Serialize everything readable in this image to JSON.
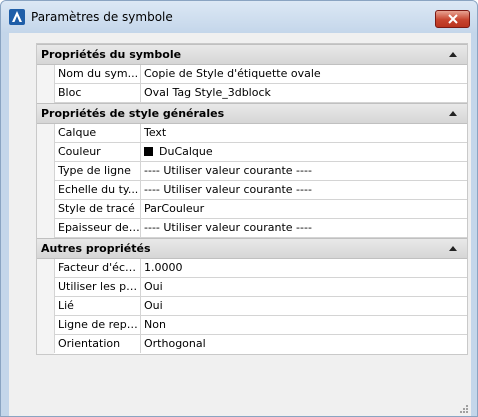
{
  "window": {
    "title": "Paramètres de symbole",
    "close_label": "×"
  },
  "categories": [
    {
      "title": "Propriétés du symbole",
      "rows": [
        {
          "name": "Nom du sym...",
          "value": "Copie de Style d'étiquette ovale"
        },
        {
          "name": "Bloc",
          "value": "Oval Tag Style_3dblock"
        }
      ]
    },
    {
      "title": "Propriétés de style générales",
      "rows": [
        {
          "name": "Calque",
          "value": "Text"
        },
        {
          "name": "Couleur",
          "value": "DuCalque",
          "swatch": "#000000"
        },
        {
          "name": "Type de ligne",
          "value": "---- Utiliser valeur courante ----"
        },
        {
          "name": "Echelle du ty...",
          "value": "---- Utiliser valeur courante ----"
        },
        {
          "name": "Style de tracé",
          "value": "ParCouleur"
        },
        {
          "name": "Epaisseur de l...",
          "value": "---- Utiliser valeur courante ----"
        }
      ]
    },
    {
      "title": "Autres propriétés",
      "rows": [
        {
          "name": "Facteur d'éch...",
          "value": "1.0000"
        },
        {
          "name": "Utiliser les pr...",
          "value": "Oui"
        },
        {
          "name": "Lié",
          "value": "Oui"
        },
        {
          "name": "Ligne de repère",
          "value": "Non"
        },
        {
          "name": "Orientation",
          "value": "Orthogonal"
        }
      ]
    }
  ],
  "icons": {
    "app": "autocad-logo-icon",
    "collapse": "collapse-arrow-icon",
    "close": "close-icon"
  },
  "colors": {
    "titlebar": "#c4d6ea",
    "close_button": "#c7452f",
    "category_header": "#d6d6d6"
  }
}
